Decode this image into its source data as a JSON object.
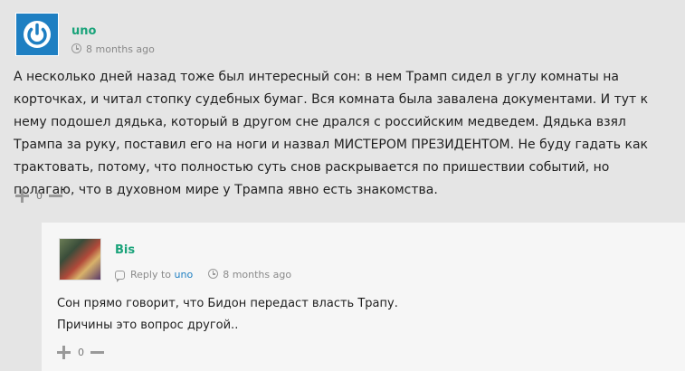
{
  "main_comment": {
    "author": "uno",
    "time": "8 months ago",
    "text": "А несколько дней назад тоже был интересный сон: в нем Трамп сидел в углу комнаты на корточках, и читал стопку судебных бумаг. Вся комната была завалена документами. И тут к нему подошел дядька, который в другом сне дрался с российским медведем. Дядька взял Трампа за руку, поставил его на ноги и назвал МИСТЕРОМ ПРЕЗИДЕНТОМ. Не буду гадать как трактовать, потому, что полностью суть снов раскрывается по пришествии событий, но полагаю, что в духовном мире у Трампа явно есть знакомства.",
    "votes": "0",
    "avatar_icon": "power-icon"
  },
  "reply_comment": {
    "author": "Bis",
    "reply_prefix": "Reply to",
    "reply_to": "uno",
    "time": "8 months ago",
    "lines": [
      "Сон прямо говорит, что Бидон передаст власть Трапу.",
      "Причины это вопрос другой.."
    ],
    "votes": "0"
  },
  "colors": {
    "author": "#1aa37a",
    "link": "#1e7fc2",
    "avatar_bg": "#1e7fc2"
  }
}
